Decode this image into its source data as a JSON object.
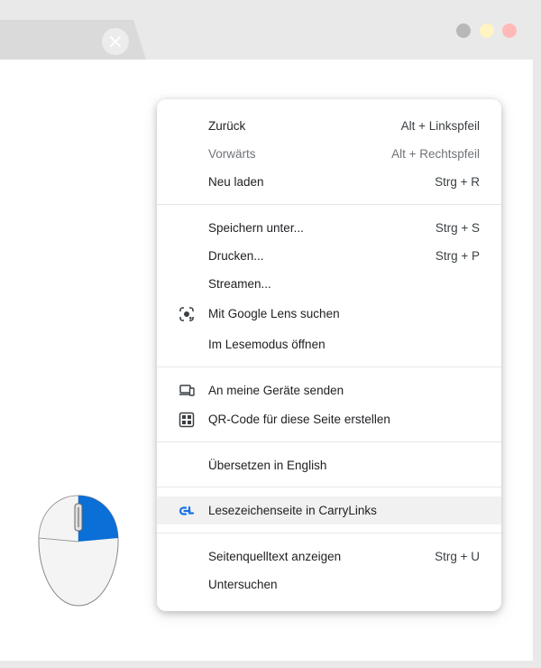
{
  "window": {
    "traffic_lights": [
      "#b8b8b8",
      "#fff4c2",
      "#ffb9b9"
    ]
  },
  "context_menu": {
    "accent": "#1a73e8",
    "groups": [
      [
        {
          "label": "Zurück",
          "shortcut": "Alt + Linkspfeil",
          "enabled": true
        },
        {
          "label": "Vorwärts",
          "shortcut": "Alt + Rechtspfeil",
          "enabled": false
        },
        {
          "label": "Neu laden",
          "shortcut": "Strg + R",
          "enabled": true
        }
      ],
      [
        {
          "label": "Speichern unter...",
          "shortcut": "Strg + S"
        },
        {
          "label": "Drucken...",
          "shortcut": "Strg + P"
        },
        {
          "label": "Streamen..."
        },
        {
          "label": "Mit Google Lens suchen",
          "icon": "google-lens-icon"
        },
        {
          "label": "Im Lesemodus öffnen"
        }
      ],
      [
        {
          "label": "An meine Geräte senden",
          "icon": "devices-icon"
        },
        {
          "label": "QR-Code für diese Seite erstellen",
          "icon": "qr-code-icon"
        }
      ],
      [
        {
          "label": "Übersetzen in English"
        }
      ],
      [
        {
          "label": "Lesezeichenseite in CarryLinks",
          "icon": "carrylinks-icon",
          "highlighted": true
        }
      ],
      [
        {
          "label": "Seitenquelltext anzeigen",
          "shortcut": "Strg + U"
        },
        {
          "label": "Untersuchen"
        }
      ]
    ]
  },
  "mouse_illustration": {
    "pressed_button": "right",
    "pressed_color": "#0a6fd6"
  }
}
